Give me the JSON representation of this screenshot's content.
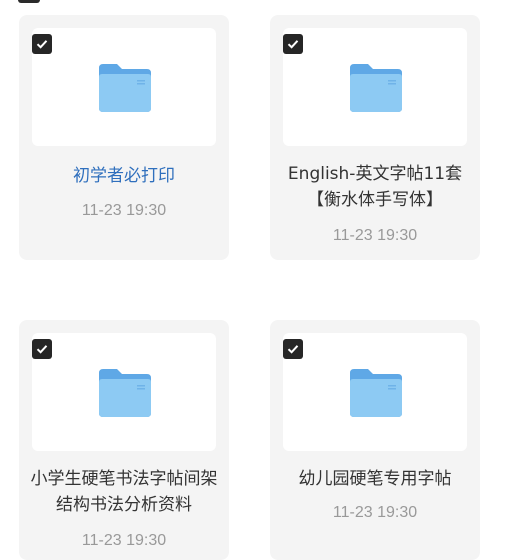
{
  "files": [
    {
      "name": "初学者必打印",
      "date": "11-23 19:30",
      "checked": true
    },
    {
      "name": "English-英文字帖11套【衡水体手写体】",
      "date": "11-23 19:30",
      "checked": true
    },
    {
      "name": "小学生硬笔书法字帖间架结构书法分析资料",
      "date": "11-23 19:30",
      "checked": true
    },
    {
      "name": "幼儿园硬笔专用字帖",
      "date": "11-23 19:30",
      "checked": true
    }
  ],
  "icons": {
    "folder": "folder-icon",
    "check": "checkmark-icon"
  },
  "colors": {
    "folder_front": "#86c6f2",
    "folder_back": "#5fa8e6",
    "link": "#2f6fbd",
    "checkbox": "#262626"
  }
}
